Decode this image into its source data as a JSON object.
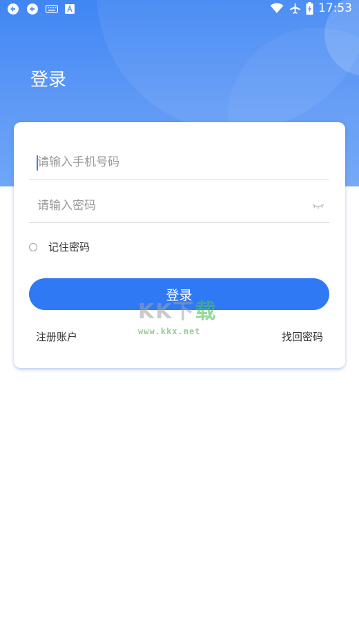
{
  "status_bar": {
    "time": "17:53",
    "left_icons": [
      "sync-icon",
      "sync-icon",
      "keyboard-icon",
      "font-icon"
    ],
    "right_icons": [
      "wifi-icon",
      "airplane-mode-icon",
      "battery-charging-icon"
    ]
  },
  "header": {
    "title": "登录"
  },
  "form": {
    "phone": {
      "placeholder": "请输入手机号码",
      "value": ""
    },
    "password": {
      "placeholder": "请输入密码",
      "value": "",
      "toggle_icon": "eye-closed-icon"
    },
    "remember": {
      "label": "记住密码",
      "checked": false
    },
    "login_button": "登录",
    "register_link": "注册账户",
    "forgot_link": "找回密码"
  },
  "watermark": {
    "logo_text": [
      "K",
      "K",
      "下",
      "载"
    ],
    "url": "www.kkx.net"
  },
  "colors": {
    "primary": "#3079f5",
    "header_gradient_top": "#3f86f4",
    "header_gradient_bottom": "#6ea6f7",
    "text": "#333333",
    "placeholder": "#9a9a9a"
  }
}
